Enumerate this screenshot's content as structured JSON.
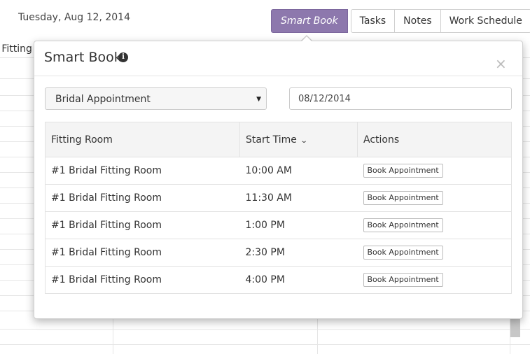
{
  "header": {
    "date": "Tuesday, Aug 12, 2014",
    "background_column_label": "l Fitting"
  },
  "toolbar": {
    "buttons": [
      {
        "label": "Smart Book",
        "active": true
      },
      {
        "label": "Tasks",
        "active": false
      },
      {
        "label": "Notes",
        "active": false
      },
      {
        "label": "Work Schedule",
        "active": false
      }
    ]
  },
  "popover": {
    "title": "Smart Book",
    "info_icon": "info-icon",
    "close_icon": "close-icon",
    "appointment_type": "Bridal Appointment",
    "date_value": "08/12/2014",
    "table": {
      "columns": [
        "Fitting Room",
        "Start Time",
        "Actions"
      ],
      "rows": [
        {
          "room": "#1 Bridal Fitting Room",
          "time": "10:00 AM",
          "action": "Book Appointment"
        },
        {
          "room": "#1 Bridal Fitting Room",
          "time": "11:30 AM",
          "action": "Book Appointment"
        },
        {
          "room": "#1 Bridal Fitting Room",
          "time": "1:00 PM",
          "action": "Book Appointment"
        },
        {
          "room": "#1 Bridal Fitting Room",
          "time": "2:30 PM",
          "action": "Book Appointment"
        },
        {
          "room": "#1 Bridal Fitting Room",
          "time": "4:00 PM",
          "action": "Book Appointment"
        }
      ]
    }
  },
  "colors": {
    "accent": "#8d78ad"
  }
}
